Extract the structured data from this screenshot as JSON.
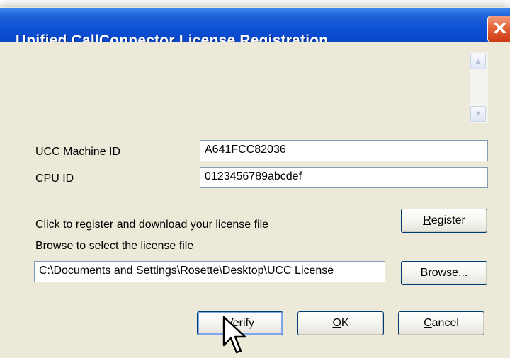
{
  "window": {
    "title": "Unified CallConnector License Registration",
    "close_glyph": "✕"
  },
  "scrollbar": {
    "up_glyph": "▲",
    "down_glyph": "▼"
  },
  "form": {
    "machine_id_label": "UCC Machine ID",
    "machine_id_value": "A641FCC82036",
    "cpu_id_label": "CPU ID",
    "cpu_id_value": "0123456789abcdef",
    "register_prompt": "Click to register and download your license file",
    "browse_prompt": "Browse to select the license file",
    "license_path": "C:\\Documents and Settings\\Rosette\\Desktop\\UCC License"
  },
  "buttons": {
    "register": {
      "mnemonic": "R",
      "rest": "egister"
    },
    "browse": {
      "mnemonic": "B",
      "rest": "rowse..."
    },
    "verify": {
      "mnemonic": "V",
      "rest": "erify"
    },
    "ok": {
      "mnemonic": "O",
      "rest": "K"
    },
    "cancel": {
      "mnemonic": "C",
      "rest": "ancel"
    }
  },
  "colors": {
    "titlebar": "#0a4ed3",
    "face": "#ece9d8",
    "close": "#e36339",
    "button_border": "#003c74"
  }
}
